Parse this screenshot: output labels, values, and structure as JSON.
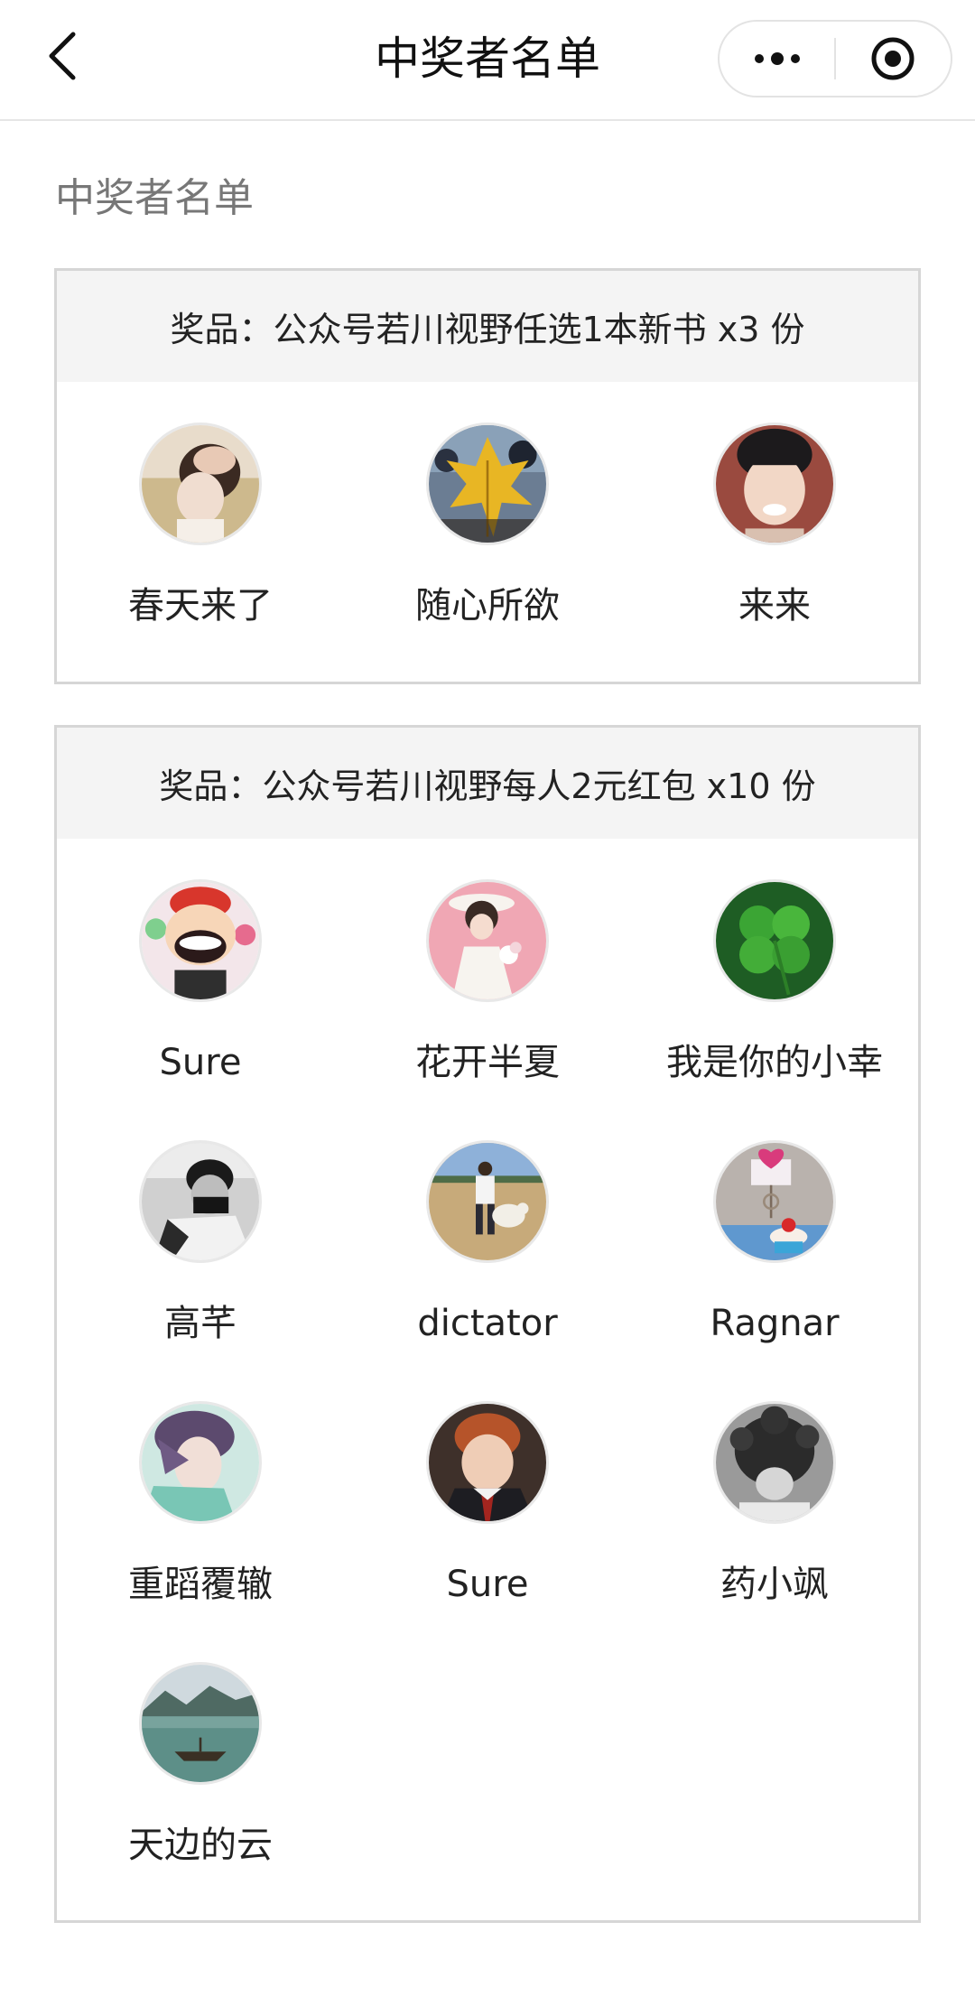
{
  "nav": {
    "title": "中奖者名单",
    "back_icon": "chevron-left-icon",
    "more_icon": "more-dots-icon",
    "close_icon": "target-circle-icon"
  },
  "section_heading": "中奖者名单",
  "prizes": [
    {
      "label": "奖品：公众号若川视野任选1本新书 x3 份",
      "winners": [
        {
          "name": "春天来了",
          "avatar_icon": "avatar-person-hair"
        },
        {
          "name": "随心所欲",
          "avatar_icon": "avatar-maple-leaf"
        },
        {
          "name": "来来",
          "avatar_icon": "avatar-young-man"
        }
      ]
    },
    {
      "label": "奖品：公众号若川视野每人2元红包 x10 份",
      "winners": [
        {
          "name": "Sure",
          "avatar_icon": "avatar-cartoon"
        },
        {
          "name": "花开半夏",
          "avatar_icon": "avatar-woman-flowers"
        },
        {
          "name": "我是你的小幸",
          "avatar_icon": "avatar-clover"
        },
        {
          "name": "高芊",
          "avatar_icon": "avatar-masked-person"
        },
        {
          "name": "dictator",
          "avatar_icon": "avatar-person-sheep"
        },
        {
          "name": "Ragnar",
          "avatar_icon": "avatar-cupcake"
        },
        {
          "name": "重蹈覆辙",
          "avatar_icon": "avatar-anime-boy"
        },
        {
          "name": "Sure",
          "avatar_icon": "avatar-red-hair-boy"
        },
        {
          "name": "药小飒",
          "avatar_icon": "avatar-bw-portrait"
        },
        {
          "name": "天边的云",
          "avatar_icon": "avatar-lake-boat"
        }
      ]
    }
  ]
}
